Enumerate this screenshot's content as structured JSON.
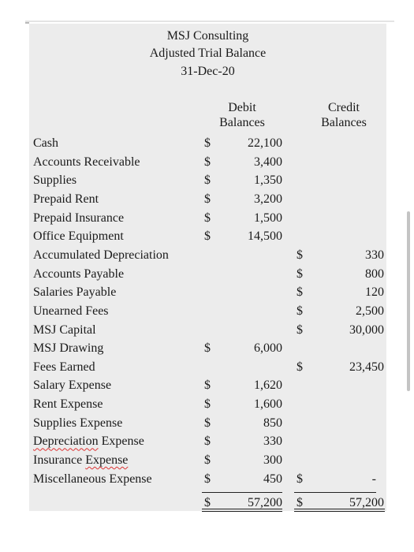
{
  "report": {
    "company": "MSJ Consulting",
    "title": "Adjusted Trial Balance",
    "date": "31-Dec-20"
  },
  "columns": {
    "debit_line1": "Debit",
    "debit_line2": "Balances",
    "credit_line1": "Credit",
    "credit_line2": "Balances"
  },
  "currency_symbol": "$",
  "accounts": [
    {
      "name": "Cash",
      "debit": "22,100",
      "credit": ""
    },
    {
      "name": "Accounts Receivable",
      "debit": "3,400",
      "credit": ""
    },
    {
      "name": "Supplies",
      "debit": "1,350",
      "credit": ""
    },
    {
      "name": "Prepaid Rent",
      "debit": "3,200",
      "credit": ""
    },
    {
      "name": "Prepaid Insurance",
      "debit": "1,500",
      "credit": ""
    },
    {
      "name": "Office Equipment",
      "debit": "14,500",
      "credit": ""
    },
    {
      "name": "Accumulated Depreciation",
      "debit": "",
      "credit": "330"
    },
    {
      "name": "Accounts Payable",
      "debit": "",
      "credit": "800"
    },
    {
      "name": "Salaries Payable",
      "debit": "",
      "credit": "120"
    },
    {
      "name": "Unearned Fees",
      "debit": "",
      "credit": "2,500"
    },
    {
      "name": "MSJ Capital",
      "debit": "",
      "credit": "30,000"
    },
    {
      "name": "MSJ Drawing",
      "debit": "6,000",
      "credit": ""
    },
    {
      "name": "Fees Earned",
      "debit": "",
      "credit": "23,450"
    },
    {
      "name": "Salary Expense",
      "debit": "1,620",
      "credit": ""
    },
    {
      "name": "Rent Expense",
      "debit": "1,600",
      "credit": ""
    },
    {
      "name": "Supplies Expense",
      "debit": "850",
      "credit": ""
    },
    {
      "name_pre": "Depreciation",
      "name_post": " Expense",
      "spellcheck_word": "Depreciation",
      "debit": "330",
      "credit": ""
    },
    {
      "name_pre": "Insurance ",
      "name_post": "Expense",
      "spellcheck_word": "Expense",
      "debit": "300",
      "credit": ""
    },
    {
      "name": "Miscellaneous Expense",
      "debit": "450",
      "credit": "-"
    }
  ],
  "totals": {
    "debit": "57,200",
    "credit": "57,200"
  }
}
